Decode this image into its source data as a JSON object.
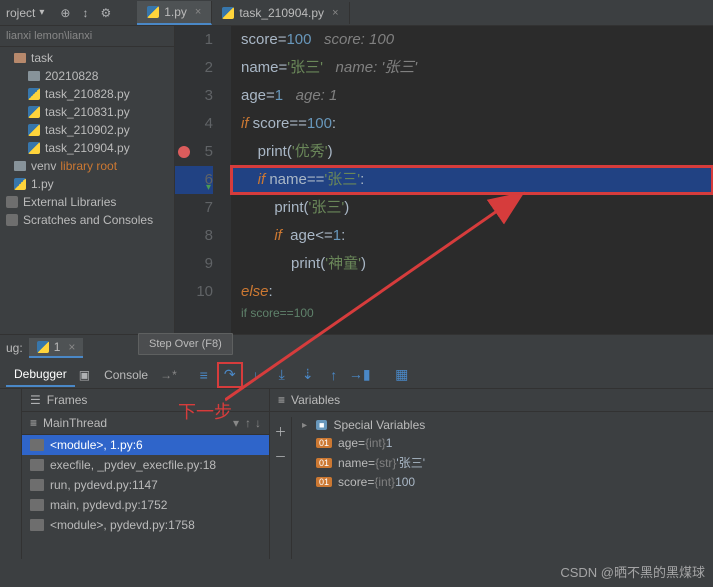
{
  "toolbar": {
    "project_label": "roject",
    "dropdown": "▾"
  },
  "crumb": "lianxi  lemon\\lianxi",
  "tree": {
    "task": "task",
    "date_dir": "20210828",
    "files": [
      "task_210828.py",
      "task_210831.py",
      "task_210902.py",
      "task_210904.py"
    ],
    "venv": "venv",
    "venv_note": "library root",
    "root_file": "1.py",
    "ext_libs": "External Libraries",
    "scratches": "Scratches and Consoles"
  },
  "tabs": {
    "t1": "1.py",
    "t2": "task_210904.py"
  },
  "code": {
    "l1a": "score",
    "l1b": "=",
    "l1c": "100",
    "l1cmt": "score: 100",
    "l2a": "name",
    "l2b": "=",
    "l2c": "'张三'",
    "l2cmt": "name: '张三'",
    "l3a": "age",
    "l3b": "=",
    "l3c": "1",
    "l3cmt": "age: 1",
    "l4a": "if",
    "l4b": " score",
    "l4c": "==",
    "l4d": "100",
    "l4e": ":",
    "l5a": "print",
    "l5b": "(",
    "l5c": "'优秀'",
    "l5d": ")",
    "l6a": "if",
    "l6b": " name",
    "l6c": "==",
    "l6d": "'张三'",
    "l6e": ":",
    "l7a": "print",
    "l7b": "(",
    "l7c": "'张三'",
    "l7d": ")",
    "l8a": "if",
    "l8b": "  age",
    "l8c": "<=",
    "l8d": "1",
    "l8e": ":",
    "l9a": "print",
    "l9b": "(",
    "l9c": "'神童'",
    "l9d": ")",
    "l10a": "else",
    "l10b": ":",
    "hint": "if score==100"
  },
  "lines": [
    "1",
    "2",
    "3",
    "4",
    "5",
    "6",
    "7",
    "8",
    "9",
    "10"
  ],
  "debug": {
    "prefix": "ug:",
    "run_name": "1",
    "tooltip": "Step Over (F8)",
    "tab_debugger": "Debugger",
    "tab_console": "Console",
    "frames_title": "Frames",
    "thread": "MainThread",
    "frames": [
      "<module>, 1.py:6",
      "execfile, _pydev_execfile.py:18",
      "run, pydevd.py:1147",
      "main, pydevd.py:1752",
      "<module>, pydevd.py:1758"
    ],
    "vars_title": "Variables",
    "special": "Special Variables",
    "vars": [
      {
        "n": "age",
        "t": "{int}",
        "v": "1"
      },
      {
        "n": "name",
        "t": "{str}",
        "v": "'张三'"
      },
      {
        "n": "score",
        "t": "{int}",
        "v": "100"
      }
    ]
  },
  "anno": "下一步",
  "watermark": "CSDN @晒不黑的黑煤球"
}
